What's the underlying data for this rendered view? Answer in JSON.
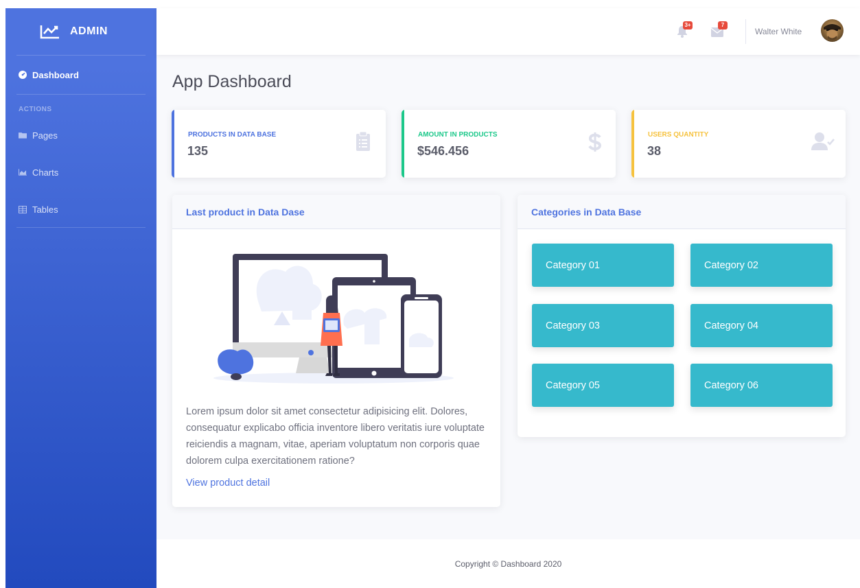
{
  "sidebar": {
    "brand": "ADMIN",
    "items": [
      {
        "label": "Dashboard",
        "icon": "tachometer-icon",
        "active": true
      },
      {
        "label": "Pages",
        "icon": "folder-icon"
      },
      {
        "label": "Charts",
        "icon": "chart-area-icon"
      },
      {
        "label": "Tables",
        "icon": "table-icon"
      }
    ],
    "heading": "ACTIONS"
  },
  "topbar": {
    "alerts_badge": "3+",
    "messages_badge": "7",
    "user_name": "Walter White"
  },
  "page_title": "App Dashboard",
  "stats": [
    {
      "label": "PRODUCTS IN DATA BASE",
      "value": "135",
      "color": "#4e73df",
      "icon": "clipboard-list-icon"
    },
    {
      "label": "AMOUNT IN PRODUCTS",
      "value": "$546.456",
      "color": "#1cc88a",
      "icon": "dollar-sign-icon"
    },
    {
      "label": "USERS QUANTITY",
      "value": "38",
      "color": "#f6c23e",
      "icon": "user-check-icon"
    }
  ],
  "last_product": {
    "title": "Last product in Data Dase",
    "description": "Lorem ipsum dolor sit amet consectetur adipisicing elit. Dolores, consequatur explicabo officia inventore libero veritatis iure voluptate reiciendis a magnam, vitae, aperiam voluptatum non corporis quae dolorem culpa exercitationem ratione?",
    "link": "View product detail"
  },
  "categories": {
    "title": "Categories in Data Base",
    "items": [
      "Category 01",
      "Category 02",
      "Category 03",
      "Category 04",
      "Category 05",
      "Category 06"
    ]
  },
  "footer": "Copyright © Dashboard 2020",
  "colors": {
    "primary": "#4e73df",
    "info": "#36b9cc",
    "success": "#1cc88a",
    "warning": "#f6c23e",
    "danger": "#e74a3b"
  }
}
